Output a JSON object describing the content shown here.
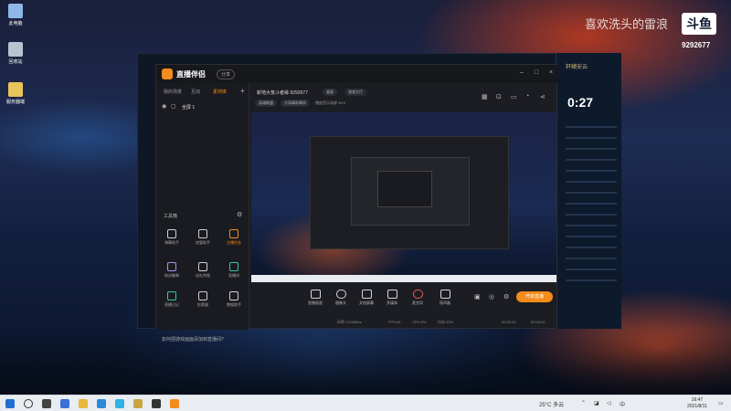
{
  "desktop": {
    "icons": [
      {
        "label": "此电脑",
        "color": "#8fb8e8"
      },
      {
        "label": "回收站",
        "color": "#b8c4d0"
      },
      {
        "label": "服务器端",
        "color": "#e8c45a"
      }
    ]
  },
  "overlay": {
    "title": "喜欢洗头的雷浪",
    "logo": "斗鱼",
    "room": "9292677"
  },
  "game_client": {
    "user": "轩辕安云",
    "clock": "0:27"
  },
  "app": {
    "name": "直播伴侣",
    "version": "分享",
    "left_tabs": [
      "我的场景",
      "互动",
      "素材库"
    ],
    "scene_label": "全屏 1",
    "tools_title": "工具箱",
    "tools": [
      {
        "label": "弹幕助手",
        "name": "barrage-helper"
      },
      {
        "label": "房管助手",
        "name": "room-manager"
      },
      {
        "label": "主播任务",
        "name": "anchor-task"
      },
      {
        "label": "粉丝徽章",
        "name": "fan-badge"
      },
      {
        "label": "送礼特效",
        "name": "gift-effect"
      },
      {
        "label": "直播间",
        "name": "live-room"
      },
      {
        "label": "直播日记",
        "name": "live-diary"
      },
      {
        "label": "投票器",
        "name": "voter"
      },
      {
        "label": "数据助手",
        "name": "data-helper"
      }
    ],
    "bottom_tip": "如何把游戏画面添加到直播间?",
    "stream_title": "斩地大荒斗者缘 9292677",
    "chips": [
      "画面",
      "游戏大厅"
    ],
    "sub_tags": [
      "英雄联盟",
      "分享精彩瞬间",
      "查看历史开播"
    ],
    "sub_text": "播放音乐录屏 99.9",
    "controls": [
      {
        "label": "直播画面",
        "name": "live-screen"
      },
      {
        "label": "摄像头",
        "name": "camera"
      },
      {
        "label": "文档屏幕",
        "name": "document"
      },
      {
        "label": "多媒体",
        "name": "media"
      },
      {
        "label": "麦克风",
        "name": "microphone"
      },
      {
        "label": "扬声器",
        "name": "speaker"
      }
    ],
    "start_live": "开启直播",
    "status": [
      "码率:12345kbs",
      "FPS:60",
      "CPU:5%",
      "内存:33%",
      "00:00:00",
      "00:00:00"
    ]
  },
  "taskbar": {
    "weather": "25°C 多云",
    "time": "16:47",
    "date": "2021/8/11"
  }
}
